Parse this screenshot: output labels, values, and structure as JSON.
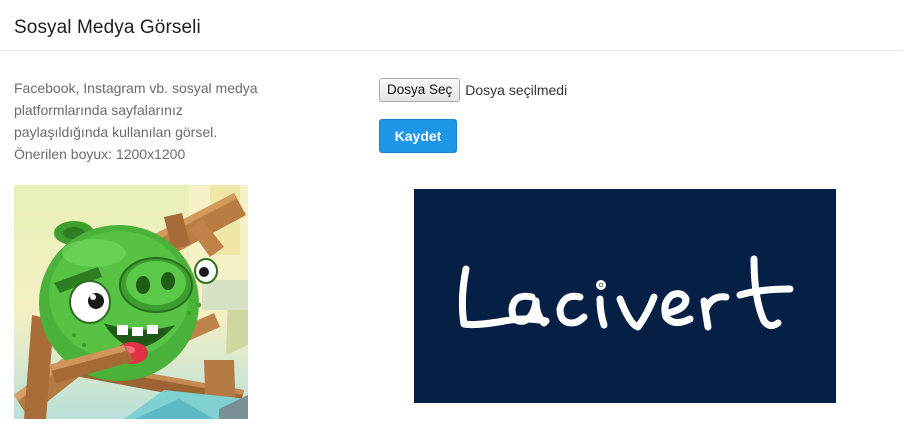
{
  "section": {
    "title": "Sosyal Medya Görseli"
  },
  "description": {
    "lines": [
      "Facebook, Instagram vb. sosyal medya",
      "platformlarında sayfalarınız",
      "paylaşıldığında kullanılan görsel.",
      "Önerilen boyux: 1200x1200"
    ]
  },
  "file_input": {
    "button_label": "Dosya Seç",
    "status": "Dosya seçilmedi"
  },
  "save_button": {
    "label": "Kaydet"
  },
  "previews": {
    "current_image_icon": "angry-birds-green-pig",
    "new_image_text": "Lacivert"
  },
  "colors": {
    "accent": "#1e96e8",
    "navy": "#051f45"
  }
}
